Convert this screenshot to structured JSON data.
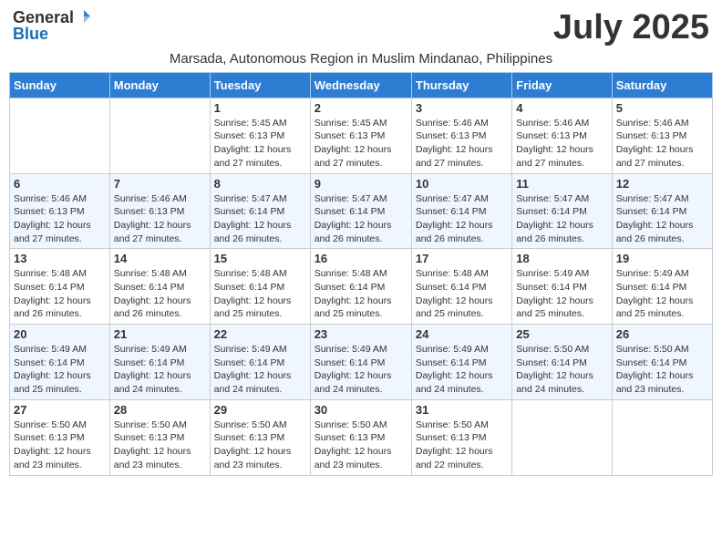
{
  "logo": {
    "general": "General",
    "blue": "Blue"
  },
  "title": "July 2025",
  "location": "Marsada, Autonomous Region in Muslim Mindanao, Philippines",
  "weekdays": [
    "Sunday",
    "Monday",
    "Tuesday",
    "Wednesday",
    "Thursday",
    "Friday",
    "Saturday"
  ],
  "weeks": [
    [
      {
        "day": "",
        "info": ""
      },
      {
        "day": "",
        "info": ""
      },
      {
        "day": "1",
        "info": "Sunrise: 5:45 AM\nSunset: 6:13 PM\nDaylight: 12 hours and 27 minutes."
      },
      {
        "day": "2",
        "info": "Sunrise: 5:45 AM\nSunset: 6:13 PM\nDaylight: 12 hours and 27 minutes."
      },
      {
        "day": "3",
        "info": "Sunrise: 5:46 AM\nSunset: 6:13 PM\nDaylight: 12 hours and 27 minutes."
      },
      {
        "day": "4",
        "info": "Sunrise: 5:46 AM\nSunset: 6:13 PM\nDaylight: 12 hours and 27 minutes."
      },
      {
        "day": "5",
        "info": "Sunrise: 5:46 AM\nSunset: 6:13 PM\nDaylight: 12 hours and 27 minutes."
      }
    ],
    [
      {
        "day": "6",
        "info": "Sunrise: 5:46 AM\nSunset: 6:13 PM\nDaylight: 12 hours and 27 minutes."
      },
      {
        "day": "7",
        "info": "Sunrise: 5:46 AM\nSunset: 6:13 PM\nDaylight: 12 hours and 27 minutes."
      },
      {
        "day": "8",
        "info": "Sunrise: 5:47 AM\nSunset: 6:14 PM\nDaylight: 12 hours and 26 minutes."
      },
      {
        "day": "9",
        "info": "Sunrise: 5:47 AM\nSunset: 6:14 PM\nDaylight: 12 hours and 26 minutes."
      },
      {
        "day": "10",
        "info": "Sunrise: 5:47 AM\nSunset: 6:14 PM\nDaylight: 12 hours and 26 minutes."
      },
      {
        "day": "11",
        "info": "Sunrise: 5:47 AM\nSunset: 6:14 PM\nDaylight: 12 hours and 26 minutes."
      },
      {
        "day": "12",
        "info": "Sunrise: 5:47 AM\nSunset: 6:14 PM\nDaylight: 12 hours and 26 minutes."
      }
    ],
    [
      {
        "day": "13",
        "info": "Sunrise: 5:48 AM\nSunset: 6:14 PM\nDaylight: 12 hours and 26 minutes."
      },
      {
        "day": "14",
        "info": "Sunrise: 5:48 AM\nSunset: 6:14 PM\nDaylight: 12 hours and 26 minutes."
      },
      {
        "day": "15",
        "info": "Sunrise: 5:48 AM\nSunset: 6:14 PM\nDaylight: 12 hours and 25 minutes."
      },
      {
        "day": "16",
        "info": "Sunrise: 5:48 AM\nSunset: 6:14 PM\nDaylight: 12 hours and 25 minutes."
      },
      {
        "day": "17",
        "info": "Sunrise: 5:48 AM\nSunset: 6:14 PM\nDaylight: 12 hours and 25 minutes."
      },
      {
        "day": "18",
        "info": "Sunrise: 5:49 AM\nSunset: 6:14 PM\nDaylight: 12 hours and 25 minutes."
      },
      {
        "day": "19",
        "info": "Sunrise: 5:49 AM\nSunset: 6:14 PM\nDaylight: 12 hours and 25 minutes."
      }
    ],
    [
      {
        "day": "20",
        "info": "Sunrise: 5:49 AM\nSunset: 6:14 PM\nDaylight: 12 hours and 25 minutes."
      },
      {
        "day": "21",
        "info": "Sunrise: 5:49 AM\nSunset: 6:14 PM\nDaylight: 12 hours and 24 minutes."
      },
      {
        "day": "22",
        "info": "Sunrise: 5:49 AM\nSunset: 6:14 PM\nDaylight: 12 hours and 24 minutes."
      },
      {
        "day": "23",
        "info": "Sunrise: 5:49 AM\nSunset: 6:14 PM\nDaylight: 12 hours and 24 minutes."
      },
      {
        "day": "24",
        "info": "Sunrise: 5:49 AM\nSunset: 6:14 PM\nDaylight: 12 hours and 24 minutes."
      },
      {
        "day": "25",
        "info": "Sunrise: 5:50 AM\nSunset: 6:14 PM\nDaylight: 12 hours and 24 minutes."
      },
      {
        "day": "26",
        "info": "Sunrise: 5:50 AM\nSunset: 6:14 PM\nDaylight: 12 hours and 23 minutes."
      }
    ],
    [
      {
        "day": "27",
        "info": "Sunrise: 5:50 AM\nSunset: 6:13 PM\nDaylight: 12 hours and 23 minutes."
      },
      {
        "day": "28",
        "info": "Sunrise: 5:50 AM\nSunset: 6:13 PM\nDaylight: 12 hours and 23 minutes."
      },
      {
        "day": "29",
        "info": "Sunrise: 5:50 AM\nSunset: 6:13 PM\nDaylight: 12 hours and 23 minutes."
      },
      {
        "day": "30",
        "info": "Sunrise: 5:50 AM\nSunset: 6:13 PM\nDaylight: 12 hours and 23 minutes."
      },
      {
        "day": "31",
        "info": "Sunrise: 5:50 AM\nSunset: 6:13 PM\nDaylight: 12 hours and 22 minutes."
      },
      {
        "day": "",
        "info": ""
      },
      {
        "day": "",
        "info": ""
      }
    ]
  ]
}
